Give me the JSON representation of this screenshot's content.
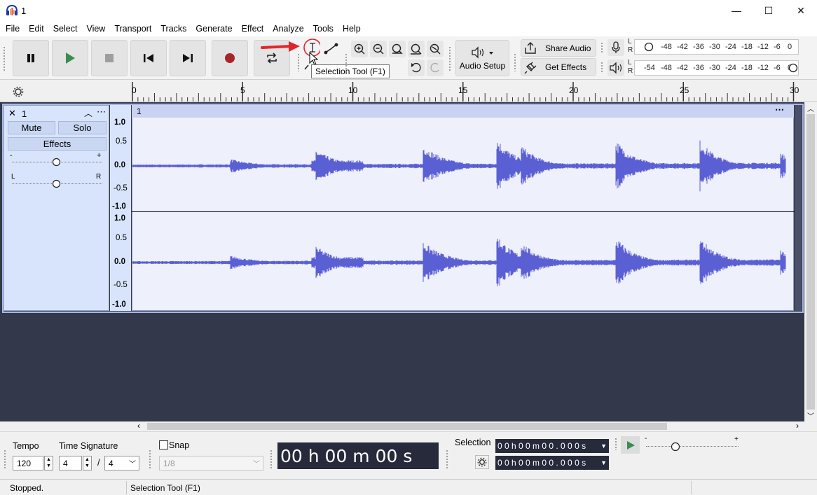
{
  "window": {
    "title": "1",
    "minimize_glyph": "—",
    "maximize_glyph": "☐",
    "close_glyph": "✕"
  },
  "menu": [
    "File",
    "Edit",
    "Select",
    "View",
    "Transport",
    "Tracks",
    "Generate",
    "Effect",
    "Analyze",
    "Tools",
    "Help"
  ],
  "toolbar": {
    "audio_setup_label": "Audio Setup",
    "share_audio_label": "Share Audio",
    "get_effects_label": "Get Effects",
    "tooltip": "Selection Tool (F1)",
    "rec_meter_ticks": [
      "L",
      "R",
      "-48",
      "-42",
      "-36",
      "-30",
      "-24",
      "-18",
      "-12",
      "-6",
      "0"
    ],
    "play_meter_ticks": [
      "L",
      "R",
      "-54",
      "-48",
      "-42",
      "-36",
      "-30",
      "-24",
      "-18",
      "-12",
      "-6",
      "0"
    ]
  },
  "ruler": {
    "ticks": [
      "0",
      "5",
      "10",
      "15",
      "20",
      "25",
      "30"
    ]
  },
  "track": {
    "name": "1",
    "clip_name": "1",
    "mute_label": "Mute",
    "solo_label": "Solo",
    "effects_label": "Effects",
    "gain_minus": "-",
    "gain_plus": "+",
    "pan_left": "L",
    "pan_right": "R",
    "scale": [
      "1.0",
      "0.5",
      "0.0",
      "-0.5",
      "-1.0"
    ]
  },
  "bottom": {
    "tempo_label": "Tempo",
    "tempo_value": "120",
    "timesig_label": "Time Signature",
    "timesig_num": "4",
    "timesig_sep": "/",
    "timesig_den": "4",
    "snap_label": "Snap",
    "snap_value": "1/8",
    "time_display": "00 h 00 m 00 s",
    "selection_label": "Selection",
    "selection_start": "0 0 h 0 0 m 0 0 . 0 0 0 s",
    "selection_end": "0 0 h 0 0 m 0 0 . 0 0 0 s"
  },
  "status": {
    "left": "Stopped.",
    "right": "Selection Tool (F1)"
  },
  "colors": {
    "waveform": "#5b5fd4",
    "record": "#a8262b",
    "play": "#3a8d4f",
    "annotation_arrow": "#e0262c"
  }
}
